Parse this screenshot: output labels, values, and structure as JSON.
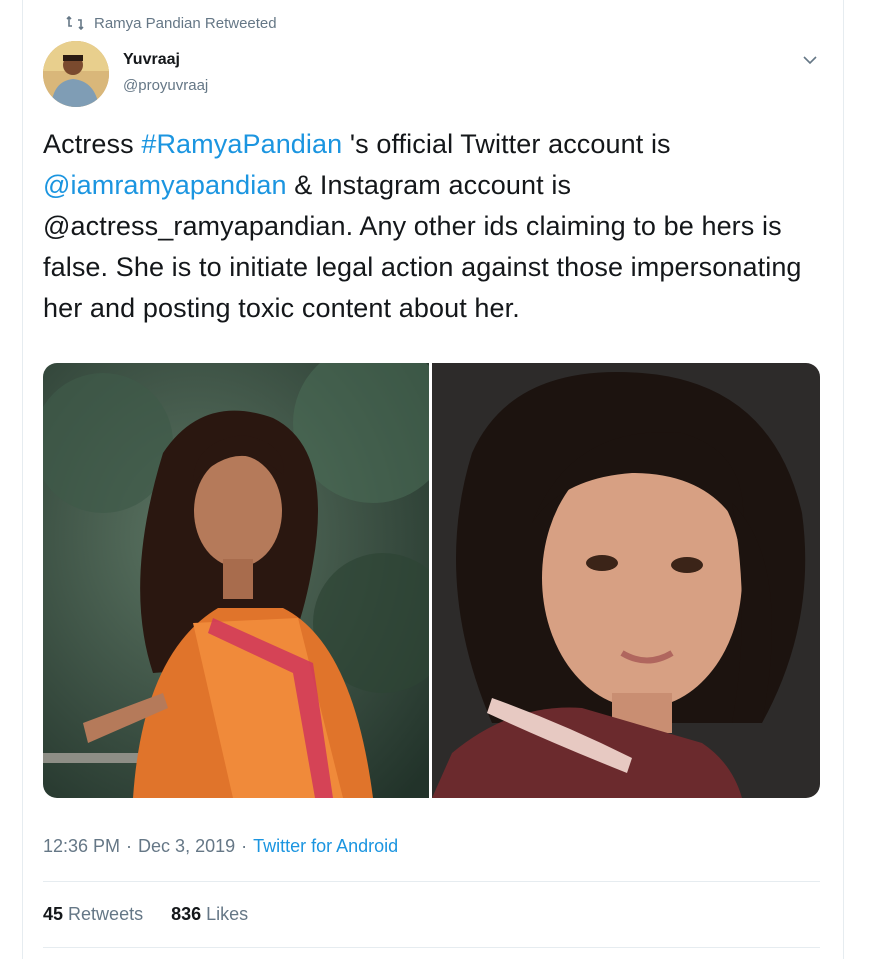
{
  "retweet_context": {
    "label": "Ramya Pandian Retweeted"
  },
  "author": {
    "name": "Yuvraaj",
    "handle": "@proyuvraaj"
  },
  "tweet": {
    "segments": [
      {
        "text": "Actress ",
        "link": false
      },
      {
        "text": "#RamyaPandian",
        "link": true
      },
      {
        "text": " 's  official Twitter account is ",
        "link": false
      },
      {
        "text": "@iamramyapandian",
        "link": true
      },
      {
        "text": " & Instagram account is @actress_ramyapandian. Any other ids claiming to be hers is false. She is to initiate legal action against those impersonating her and posting toxic content about her.",
        "link": false
      }
    ]
  },
  "media": {
    "photos": [
      {
        "name": "photo-left"
      },
      {
        "name": "photo-right"
      }
    ]
  },
  "meta": {
    "time": "12:36 PM",
    "separator": "·",
    "date": "Dec 3, 2019",
    "source": "Twitter for Android"
  },
  "stats": {
    "retweets_count": "45",
    "retweets_label": "Retweets",
    "likes_count": "836",
    "likes_label": "Likes"
  },
  "colors": {
    "link": "#1b95e0",
    "muted": "#657786",
    "text": "#14171a"
  },
  "icons": {
    "retweet": "retweet-icon",
    "caret": "chevron-down-icon"
  }
}
